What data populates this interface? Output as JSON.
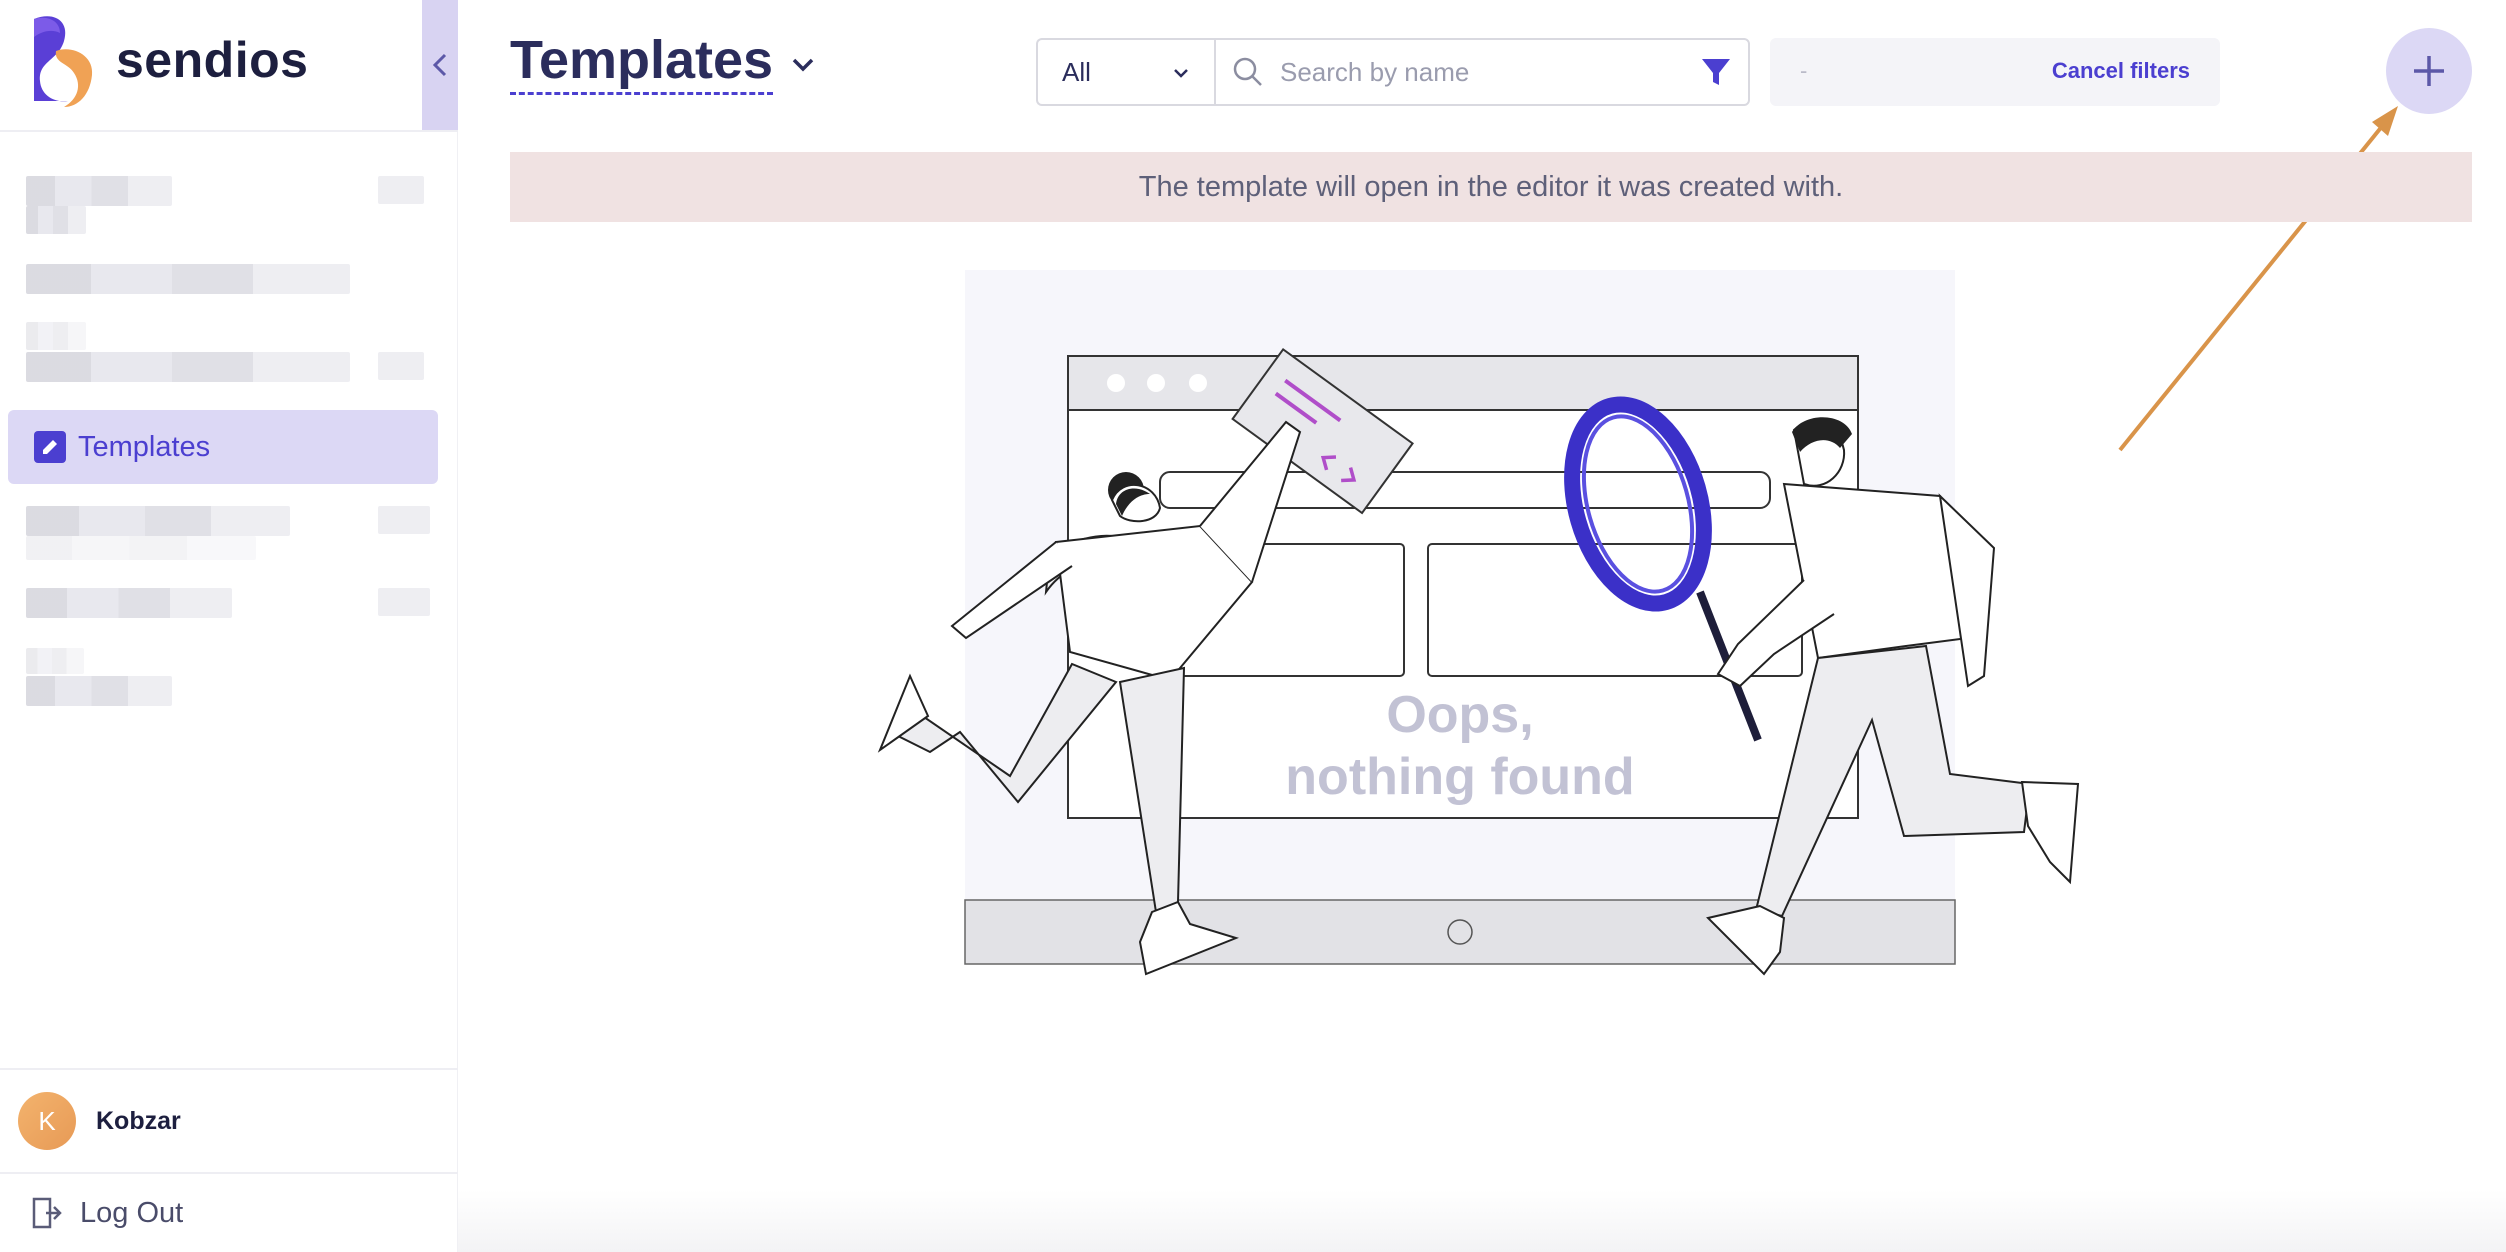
{
  "brand": {
    "name": "sendios"
  },
  "sidebar": {
    "active_item": {
      "label": "Templates"
    },
    "user": {
      "initial": "K",
      "name": "Kobzar"
    },
    "logout_label": "Log Out"
  },
  "header": {
    "title": "Templates",
    "filter_select": {
      "selected": "All"
    },
    "search": {
      "placeholder": "Search by name",
      "value": ""
    },
    "filter_panel": {
      "value": "-",
      "cancel_label": "Cancel filters"
    }
  },
  "notice": {
    "text": "The template will open in the editor it was created with."
  },
  "empty_state": {
    "line1": "Oops,",
    "line2": "nothing found"
  },
  "colors": {
    "accent": "#4b3fd0",
    "active_bg": "#dcd8f5",
    "notice_bg": "#f0e2e2",
    "annotation_arrow": "#d9944a"
  },
  "icons": [
    "logo-icon",
    "chevron-left-icon",
    "pen-icon",
    "chevron-down-icon",
    "search-icon",
    "funnel-icon",
    "plus-icon",
    "logout-icon",
    "magnifier-icon"
  ]
}
